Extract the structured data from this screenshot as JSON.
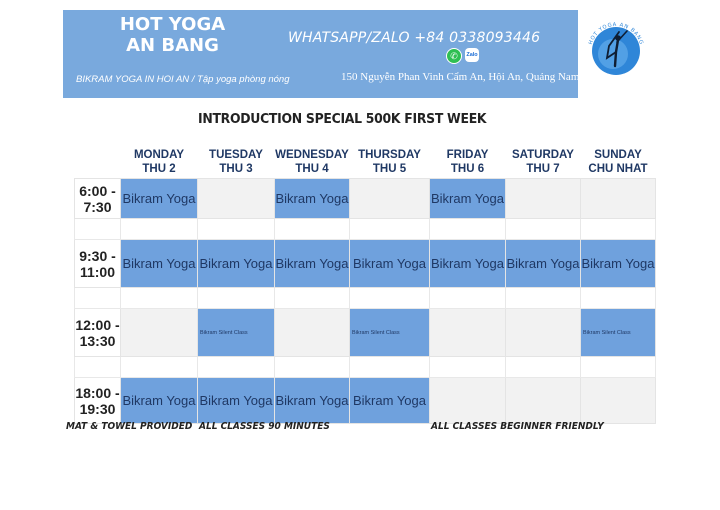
{
  "header": {
    "brand_line1": "HOT YOGA",
    "brand_line2": "AN BANG",
    "tagline": "BIKRAM YOGA IN HOI AN /  Tập yoga phòng nóng",
    "whatsapp": "WHATSAPP/ZALO +84 0338093446",
    "address": "150 Nguyễn Phan Vinh Cẩm An, Hội An, Quảng Nam",
    "zalo_icon_text": "Zalo",
    "logo_text": "HOT YOGA AN BANG",
    "icons": [
      "whatsapp-icon",
      "zalo-icon",
      "yoga-pose-logo"
    ],
    "colors": {
      "banner": "#79a9dd",
      "class_cell": "#6fa1dd",
      "header_text": "#1f3864"
    }
  },
  "title": "INTRODUCTION SPECIAL 500K FIRST WEEK",
  "schedule": {
    "days": [
      {
        "name": "MONDAY",
        "sub": "THU 2"
      },
      {
        "name": "TUESDAY",
        "sub": "THU 3"
      },
      {
        "name": "WEDNESDAY",
        "sub": "THU 4"
      },
      {
        "name": "THURSDAY",
        "sub": "THU 5"
      },
      {
        "name": "FRIDAY",
        "sub": "THU 6"
      },
      {
        "name": "SATURDAY",
        "sub": "THU 7"
      },
      {
        "name": "SUNDAY",
        "sub": "CHU NHAT"
      }
    ],
    "rows": [
      {
        "start": "6:00 -",
        "end": "7:30",
        "cells": [
          "Bikram Yoga",
          "",
          "Bikram Yoga",
          "",
          "Bikram Yoga",
          "",
          ""
        ]
      },
      {
        "start": "9:30 -",
        "end": "11:00",
        "cells": [
          "Bikram Yoga",
          "Bikram Yoga",
          "Bikram Yoga",
          "Bikram Yoga",
          "Bikram Yoga",
          "Bikram Yoga",
          "Bikram Yoga"
        ]
      },
      {
        "start": "12:00 -",
        "end": "13:30",
        "cells": [
          "",
          "Bikram Silent Class",
          "",
          "Bikram Silent Class",
          "",
          "",
          "Bikram Silent Class"
        ]
      },
      {
        "start": "18:00 -",
        "end": "19:30",
        "cells": [
          "Bikram Yoga",
          "Bikram Yoga",
          "Bikram Yoga",
          "Bikram Yoga",
          "",
          "",
          ""
        ]
      }
    ]
  },
  "footer": {
    "mat": "MAT & TOWEL PROVIDED",
    "duration": "ALL CLASSES 90 MINUTES",
    "beginner": "ALL CLASSES BEGINNER FRIENDLY"
  }
}
